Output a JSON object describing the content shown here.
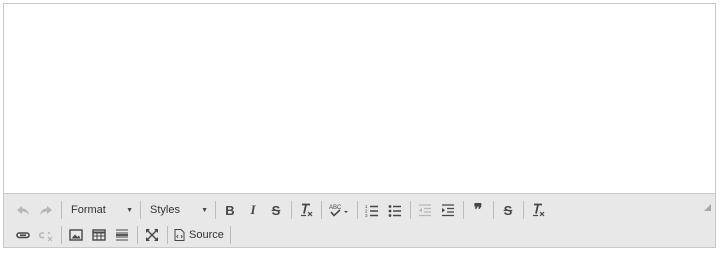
{
  "toolbar": {
    "format_label": "Format",
    "styles_label": "Styles",
    "source_label": "Source",
    "bold_glyph": "B",
    "italic_glyph": "I",
    "strike_glyph": "S",
    "clear_glyph": "I",
    "quote_glyph": "❞"
  }
}
